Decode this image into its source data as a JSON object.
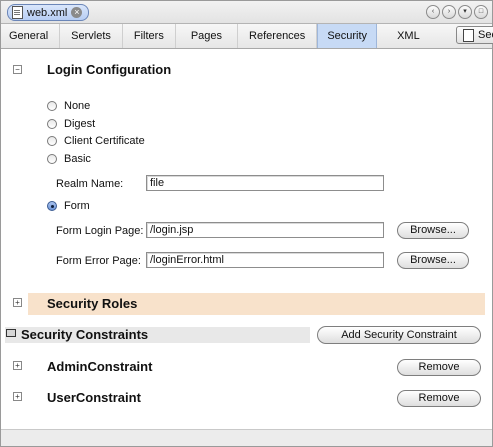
{
  "document_tab": {
    "title": "web.xml",
    "close_icon": "close-icon"
  },
  "nav_buttons": [
    "‹",
    "›",
    "▾",
    "□"
  ],
  "view_tabs": [
    {
      "label": "General",
      "active": false
    },
    {
      "label": "Servlets",
      "active": false
    },
    {
      "label": "Filters",
      "active": false
    },
    {
      "label": "Pages",
      "active": false
    },
    {
      "label": "References",
      "active": false
    },
    {
      "label": "Security",
      "active": true
    },
    {
      "label": "XML",
      "active": false
    }
  ],
  "side_button": {
    "label": "Sec"
  },
  "login_configuration": {
    "title": "Login Configuration",
    "toggle": "−",
    "options": [
      "None",
      "Digest",
      "Client Certificate",
      "Basic"
    ],
    "realm_label": "Realm Name:",
    "realm_value": "file",
    "form_option": "Form",
    "selected": "Form",
    "form_login_label": "Form Login Page:",
    "form_login_value": "/login.jsp",
    "form_error_label": "Form Error Page:",
    "form_error_value": "/loginError.html",
    "browse_label": "Browse..."
  },
  "security_roles": {
    "title": "Security Roles",
    "toggle": "+"
  },
  "security_constraints": {
    "title": "Security Constraints",
    "add_button": "Add Security Constraint",
    "items": [
      {
        "name": "AdminConstraint",
        "remove": "Remove",
        "toggle": "+"
      },
      {
        "name": "UserConstraint",
        "remove": "Remove",
        "toggle": "+"
      }
    ]
  },
  "colors": {
    "active_tab": "#c7daf5",
    "roles_band": "#f8e2cb",
    "doc_tab": "#b7cdf3"
  }
}
